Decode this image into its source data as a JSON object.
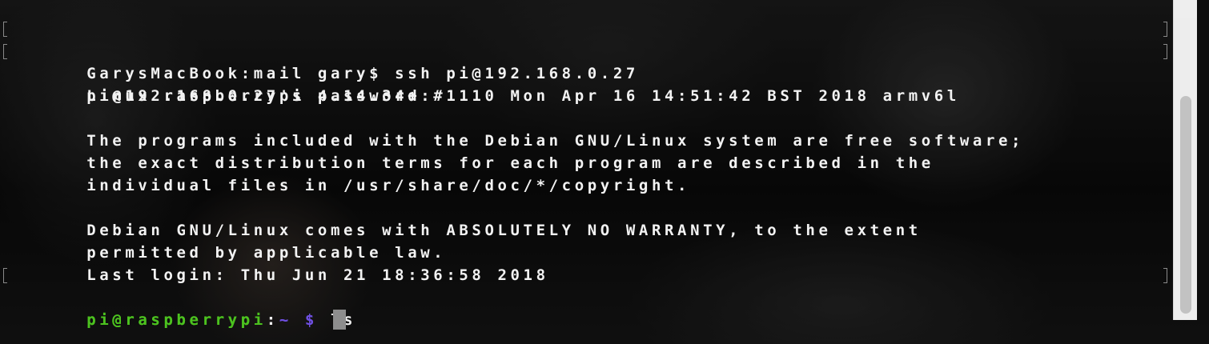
{
  "terminal": {
    "lines": [
      "GarysMacBook:mail gary$ ssh pi@192.168.0.27",
      "pi@192.168.0.27's password:",
      "Linux raspberrypi 4.14.34+ #1110 Mon Apr 16 14:51:42 BST 2018 armv6l",
      "",
      "The programs included with the Debian GNU/Linux system are free software;",
      "the exact distribution terms for each program are described in the",
      "individual files in /usr/share/doc/*/copyright.",
      "",
      "Debian GNU/Linux comes with ABSOLUTELY NO WARRANTY, to the extent",
      "permitted by applicable law.",
      "Last login: Thu Jun 21 18:36:58 2018"
    ],
    "prompt": {
      "user_host": "pi@raspberrypi",
      "separator": ":",
      "path": "~",
      "symbol": "$"
    },
    "commands": [
      "ls",
      ""
    ]
  },
  "colors": {
    "text": "#f2f2f2",
    "prompt_user": "#4cc21f",
    "prompt_path": "#6e4fe0",
    "cursor": "#8d8d8d"
  }
}
